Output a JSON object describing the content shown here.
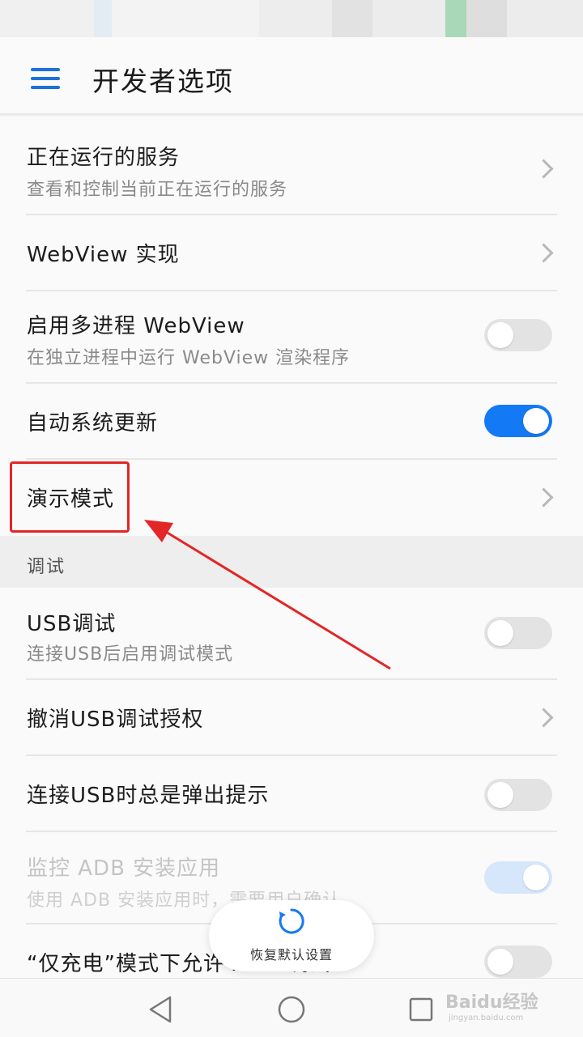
{
  "header": {
    "title": "开发者选项"
  },
  "items": [
    {
      "title": "正在运行的服务",
      "subtitle": "查看和控制当前正在运行的服务",
      "control": "chevron"
    },
    {
      "title": "WebView 实现",
      "control": "chevron"
    },
    {
      "title": "启用多进程 WebView",
      "subtitle": "在独立进程中运行 WebView 渲染程序",
      "control": "toggle",
      "checked": false
    },
    {
      "title": "自动系统更新",
      "control": "toggle",
      "checked": true
    },
    {
      "title": "演示模式",
      "control": "chevron",
      "highlighted": true
    }
  ],
  "section": {
    "label": "调试"
  },
  "debug_items": [
    {
      "title": "USB调试",
      "subtitle": "连接USB后启用调试模式",
      "control": "toggle",
      "checked": false
    },
    {
      "title": "撤消USB调试授权",
      "control": "chevron"
    },
    {
      "title": "连接USB时总是弹出提示",
      "control": "toggle",
      "checked": false
    },
    {
      "title": "监控 ADB 安装应用",
      "subtitle": "使用 ADB 安装应用时，需要用户确认",
      "control": "toggle",
      "checked": true,
      "disabled": true
    },
    {
      "title": "“仅充电”模式下允许 ADB 调试",
      "control": "toggle",
      "checked": false
    }
  ],
  "restore_button": {
    "label": "恢复默认设置"
  },
  "watermark": {
    "logo": "Baidu经验",
    "url": "jingyan.baidu.com"
  },
  "colors": {
    "accent": "#1479f4",
    "annotation": "#e32626",
    "menu_icon": "#1a73d9"
  }
}
